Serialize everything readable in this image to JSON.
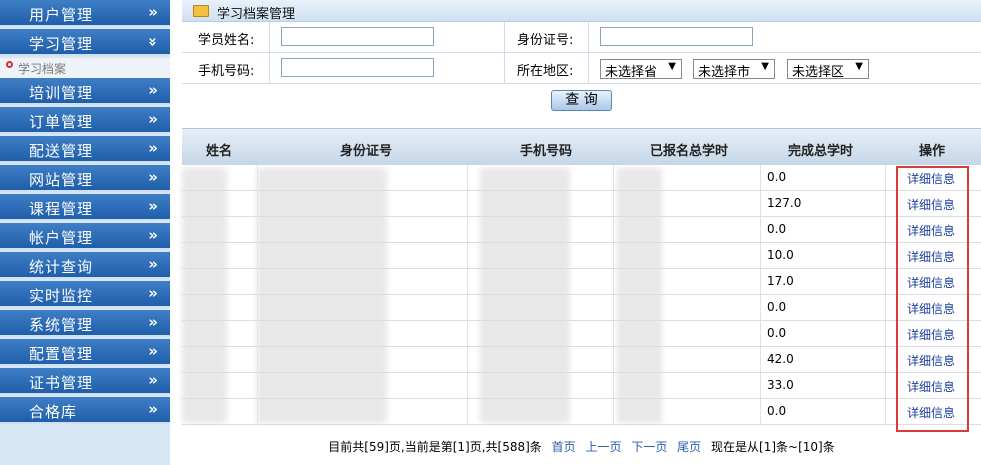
{
  "sidebar": {
    "items": [
      {
        "label": "用户管理"
      },
      {
        "label": "学习管理",
        "expanded": true
      },
      {
        "label": "培训管理"
      },
      {
        "label": "订单管理"
      },
      {
        "label": "配送管理"
      },
      {
        "label": "网站管理"
      },
      {
        "label": "课程管理"
      },
      {
        "label": "帐户管理"
      },
      {
        "label": "统计查询"
      },
      {
        "label": "实时监控"
      },
      {
        "label": "系统管理"
      },
      {
        "label": "配置管理"
      },
      {
        "label": "证书管理"
      },
      {
        "label": "合格库"
      }
    ],
    "submenu": {
      "label": "学习档案"
    },
    "chevron": "»",
    "chevron_expanded": "»"
  },
  "header": {
    "title": "学习档案管理"
  },
  "form": {
    "name_label": "学员姓名:",
    "id_label": "身份证号:",
    "phone_label": "手机号码:",
    "region_label": "所在地区:",
    "province": "未选择省",
    "city": "未选择市",
    "district": "未选择区",
    "query_button": "查 询"
  },
  "table": {
    "headers": [
      "姓名",
      "身份证号",
      "手机号码",
      "已报名总学时",
      "完成总学时",
      "操作"
    ],
    "rows": [
      {
        "completed": "0.0",
        "action": "详细信息"
      },
      {
        "completed": "127.0",
        "action": "详细信息"
      },
      {
        "completed": "0.0",
        "action": "详细信息"
      },
      {
        "completed": "10.0",
        "action": "详细信息"
      },
      {
        "completed": "17.0",
        "action": "详细信息"
      },
      {
        "completed": "0.0",
        "action": "详细信息"
      },
      {
        "completed": "0.0",
        "action": "详细信息"
      },
      {
        "completed": "42.0",
        "action": "详细信息"
      },
      {
        "completed": "33.0",
        "action": "详细信息"
      },
      {
        "completed": "0.0",
        "action": "详细信息"
      }
    ]
  },
  "pagination": {
    "summary": "目前共[59]页,当前是第[1]页,共[588]条",
    "first": "首页",
    "prev": "上一页",
    "next": "下一页",
    "last": "尾页",
    "range": "现在是从[1]条~[10]条"
  }
}
